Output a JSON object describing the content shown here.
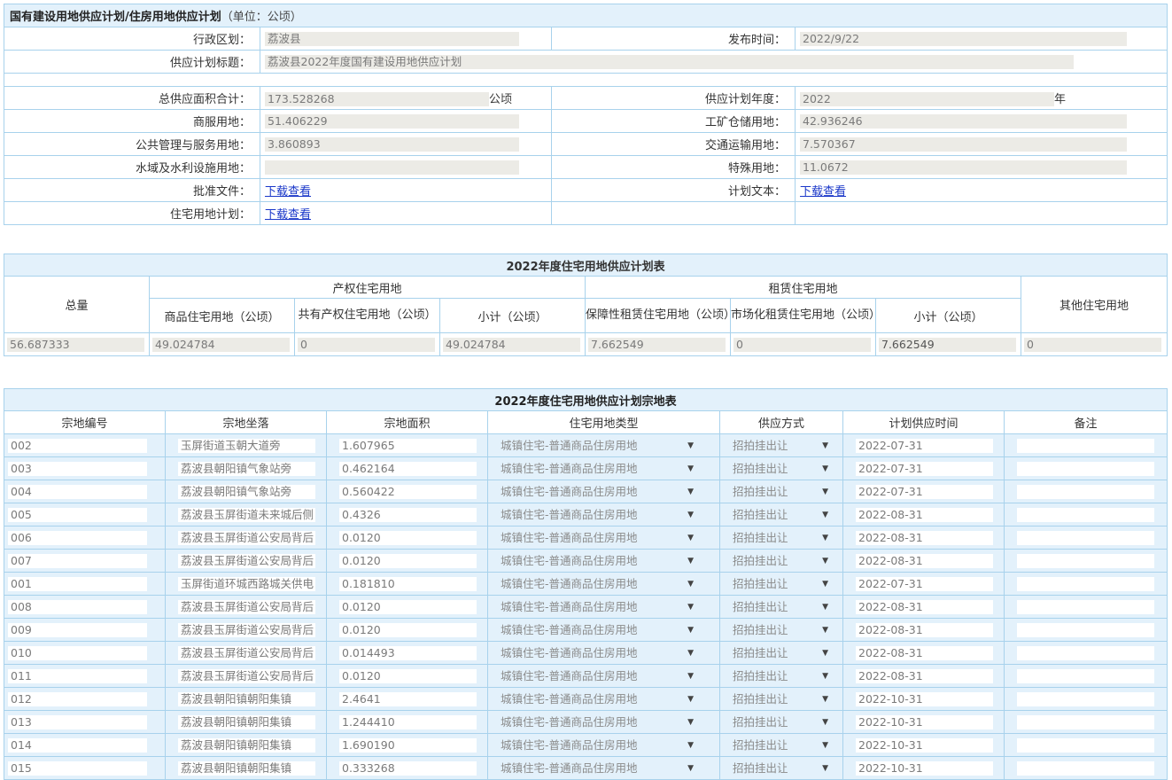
{
  "basic": {
    "title": "国有建设用地供应计划/住房用地供应计划",
    "unit": "（单位：公顷）",
    "labels": {
      "district": "行政区划：",
      "publish_time": "发布时间：",
      "plan_title": "供应计划标题：",
      "total_area": "总供应面积合计：",
      "plan_year": "供应计划年度：",
      "commercial": "商服用地：",
      "industrial": "工矿仓储用地：",
      "public": "公共管理与服务用地：",
      "transport": "交通运输用地：",
      "water": "水域及水利设施用地：",
      "special": "特殊用地：",
      "approval_doc": "批准文件：",
      "plan_text": "计划文本：",
      "housing_plan": "住宅用地计划："
    },
    "values": {
      "district": "荔波县",
      "publish_time": "2022/9/22",
      "plan_title": "荔波县2022年度国有建设用地供应计划",
      "total_area": "173.528268",
      "total_unit": "公顷",
      "plan_year": "2022",
      "year_unit": "年",
      "commercial": "51.406229",
      "industrial": "42.936246",
      "public": "3.860893",
      "transport": "7.570367",
      "water": "",
      "special": "11.0672",
      "link_text": "下载查看"
    }
  },
  "summary": {
    "title": "2022年度住宅用地供应计划表",
    "h_total": "总量",
    "h_property": "产权住宅用地",
    "h_rental": "租赁住宅用地",
    "h_other": "其他住宅用地",
    "h_commercial": "商品住宅用地（公顷）",
    "h_shared": "共有产权住宅用地（公顷）",
    "h_subtotal": "小计（公顷）",
    "h_affordable": "保障性租赁住宅用地（公顷）",
    "h_market": "市场化租赁住宅用地（公顷）",
    "h_subtotal2": "小计（公顷）",
    "values": [
      "56.687333",
      "49.024784",
      "0",
      "49.024784",
      "7.662549",
      "0",
      "7.662549",
      "0"
    ]
  },
  "detail": {
    "title": "2022年度住宅用地供应计划宗地表",
    "headers": [
      "宗地编号",
      "宗地坐落",
      "宗地面积",
      "住宅用地类型",
      "供应方式",
      "计划供应时间",
      "备注"
    ],
    "rows": [
      [
        "002",
        "玉屏街道玉朝大道旁",
        "1.607965",
        "城镇住宅-普通商品住房用地",
        "招拍挂出让",
        "2022-07-31",
        ""
      ],
      [
        "003",
        "荔波县朝阳镇气象站旁",
        "0.462164",
        "城镇住宅-普通商品住房用地",
        "招拍挂出让",
        "2022-07-31",
        ""
      ],
      [
        "004",
        "荔波县朝阳镇气象站旁",
        "0.560422",
        "城镇住宅-普通商品住房用地",
        "招拍挂出让",
        "2022-07-31",
        ""
      ],
      [
        "005",
        "荔波县玉屏街道未来城后侧",
        "0.4326",
        "城镇住宅-普通商品住房用地",
        "招拍挂出让",
        "2022-08-31",
        ""
      ],
      [
        "006",
        "荔波县玉屏街道公安局背后",
        "0.0120",
        "城镇住宅-普通商品住房用地",
        "招拍挂出让",
        "2022-08-31",
        ""
      ],
      [
        "007",
        "荔波县玉屏街道公安局背后",
        "0.0120",
        "城镇住宅-普通商品住房用地",
        "招拍挂出让",
        "2022-08-31",
        ""
      ],
      [
        "001",
        "玉屏街道环城西路城关供电",
        "0.181810",
        "城镇住宅-普通商品住房用地",
        "招拍挂出让",
        "2022-07-31",
        ""
      ],
      [
        "008",
        "荔波县玉屏街道公安局背后",
        "0.0120",
        "城镇住宅-普通商品住房用地",
        "招拍挂出让",
        "2022-08-31",
        ""
      ],
      [
        "009",
        "荔波县玉屏街道公安局背后",
        "0.0120",
        "城镇住宅-普通商品住房用地",
        "招拍挂出让",
        "2022-08-31",
        ""
      ],
      [
        "010",
        "荔波县玉屏街道公安局背后",
        "0.014493",
        "城镇住宅-普通商品住房用地",
        "招拍挂出让",
        "2022-08-31",
        ""
      ],
      [
        "011",
        "荔波县玉屏街道公安局背后",
        "0.0120",
        "城镇住宅-普通商品住房用地",
        "招拍挂出让",
        "2022-08-31",
        ""
      ],
      [
        "012",
        "荔波县朝阳镇朝阳集镇",
        "2.4641",
        "城镇住宅-普通商品住房用地",
        "招拍挂出让",
        "2022-10-31",
        ""
      ],
      [
        "013",
        "荔波县朝阳镇朝阳集镇",
        "1.244410",
        "城镇住宅-普通商品住房用地",
        "招拍挂出让",
        "2022-10-31",
        ""
      ],
      [
        "014",
        "荔波县朝阳镇朝阳集镇",
        "1.690190",
        "城镇住宅-普通商品住房用地",
        "招拍挂出让",
        "2022-10-31",
        ""
      ],
      [
        "015",
        "荔波县朝阳镇朝阳集镇",
        "0.333268",
        "城镇住宅-普通商品住房用地",
        "招拍挂出让",
        "2022-10-31",
        ""
      ]
    ],
    "dropdown_icon": "triangle-down-icon"
  }
}
